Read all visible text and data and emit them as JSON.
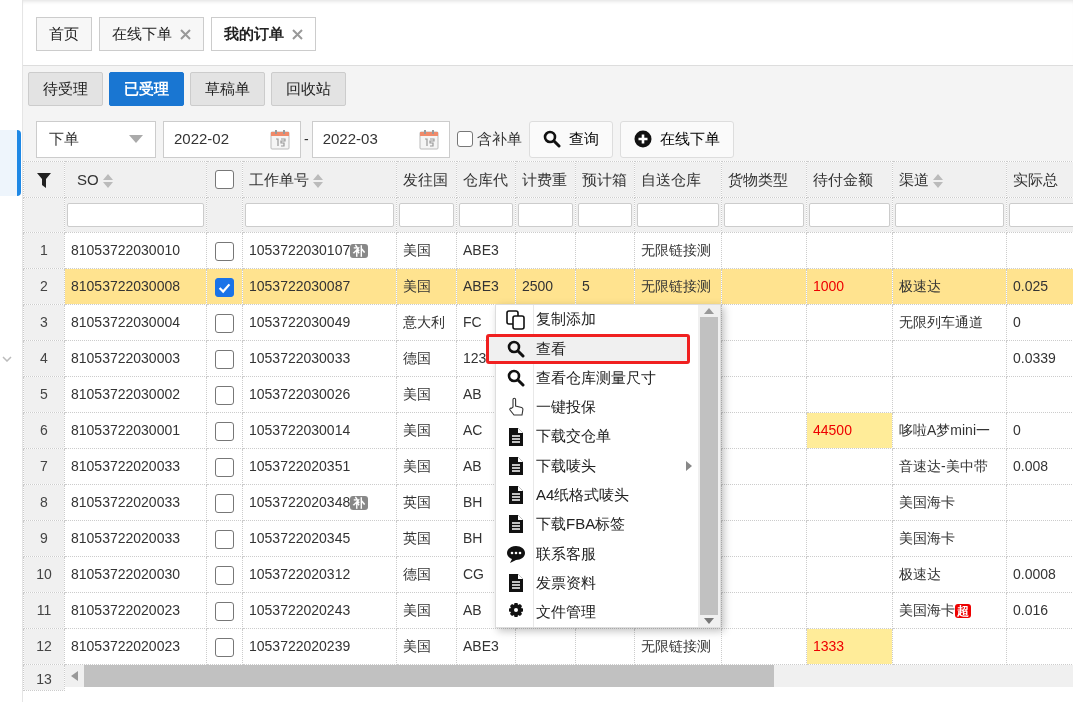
{
  "tabs": [
    {
      "label": "首页",
      "selected": false,
      "closable": false
    },
    {
      "label": "在线下单",
      "selected": false,
      "closable": true
    },
    {
      "label": "我的订单",
      "selected": true,
      "closable": true
    }
  ],
  "status_buttons": [
    {
      "label": "待受理",
      "selected": false
    },
    {
      "label": "已受理",
      "selected": true
    },
    {
      "label": "草稿单",
      "selected": false
    },
    {
      "label": "回收站",
      "selected": false
    }
  ],
  "filters": {
    "date_type": "下单",
    "date_from": "2022-02",
    "separator": "-",
    "date_to": "2022-03",
    "include_supplement": {
      "label": "含补单",
      "checked": false
    },
    "query_button": "查询",
    "new_order_button": "在线下单"
  },
  "table": {
    "header_checked": false,
    "columns": [
      {
        "kind": "text",
        "label": "SO",
        "sortable": true
      },
      {
        "kind": "checkbox"
      },
      {
        "kind": "text",
        "label": "工作单号",
        "sortable": true
      },
      {
        "kind": "text",
        "label": "发往国",
        "sortable": false
      },
      {
        "kind": "text",
        "label": "仓库代",
        "sortable": false
      },
      {
        "kind": "text",
        "label": "计费重",
        "sortable": false
      },
      {
        "kind": "text",
        "label": "预计箱",
        "sortable": false
      },
      {
        "kind": "text",
        "label": "自送仓库",
        "sortable": false
      },
      {
        "kind": "text",
        "label": "货物类型",
        "sortable": false
      },
      {
        "kind": "amount",
        "label": "待付金额",
        "sortable": false
      },
      {
        "kind": "text",
        "label": "渠道",
        "sortable": true
      },
      {
        "kind": "text",
        "label": "实际总",
        "sortable": false
      }
    ],
    "rows": [
      {
        "no": "1",
        "so": "81053722030010",
        "checked": false,
        "selected": false,
        "work_no": "1053722030107",
        "work_badge": "补",
        "country": "美国",
        "warehouse": "ABE3",
        "self_wh": "无限链接测"
      },
      {
        "no": "2",
        "so": "81053722030008",
        "checked": true,
        "selected": true,
        "work_no": "1053722030087",
        "country": "美国",
        "warehouse": "ABE3",
        "weight": "2500",
        "boxes": "5",
        "self_wh": "无限链接测",
        "amount": "1000",
        "channel": "极速达",
        "total": "0.025"
      },
      {
        "no": "3",
        "so": "81053722030004",
        "checked": false,
        "selected": false,
        "work_no": "1053722030049",
        "country": "意大利",
        "warehouse": "FC",
        "channel": "无限列车通道",
        "total": "0"
      },
      {
        "no": "4",
        "so": "81053722030003",
        "checked": false,
        "selected": false,
        "work_no": "1053722030033",
        "country": "德国",
        "warehouse": "123",
        "total": "0.0339"
      },
      {
        "no": "5",
        "so": "81053722030002",
        "checked": false,
        "selected": false,
        "work_no": "1053722030026",
        "country": "美国",
        "warehouse": "AB"
      },
      {
        "no": "6",
        "so": "81053722030001",
        "checked": false,
        "selected": false,
        "work_no": "1053722030014",
        "country": "美国",
        "warehouse": "AC",
        "amount": "44500",
        "channel": "哆啦A梦mini一",
        "total": "0"
      },
      {
        "no": "7",
        "so": "81053722020033",
        "checked": false,
        "selected": false,
        "work_no": "1053722020351",
        "country": "美国",
        "warehouse": "AB",
        "channel": "音速达-美中带",
        "total": "0.008"
      },
      {
        "no": "8",
        "so": "81053722020033",
        "checked": false,
        "selected": false,
        "work_no": "1053722020348",
        "work_badge": "补",
        "country": "英国",
        "warehouse": "BH",
        "channel": "美国海卡"
      },
      {
        "no": "9",
        "so": "81053722020033",
        "checked": false,
        "selected": false,
        "work_no": "1053722020345",
        "country": "英国",
        "warehouse": "BH",
        "channel": "美国海卡"
      },
      {
        "no": "10",
        "so": "81053722020030",
        "checked": false,
        "selected": false,
        "work_no": "1053722020312",
        "country": "德国",
        "warehouse": "CG",
        "channel": "极速达",
        "total": "0.0008"
      },
      {
        "no": "11",
        "so": "81053722020023",
        "checked": false,
        "selected": false,
        "work_no": "1053722020243",
        "country": "美国",
        "warehouse": "AB",
        "channel": "美国海卡",
        "channel_badge": "超",
        "total": "0.016"
      },
      {
        "no": "12",
        "so": "81053722020023",
        "checked": false,
        "selected": false,
        "work_no": "1053722020239",
        "country": "美国",
        "warehouse": "ABE3",
        "self_wh": "无限链接测",
        "amount": "1333"
      }
    ],
    "next_row_no": "13"
  },
  "context_menu": [
    {
      "label": "复制添加",
      "kind": "copy",
      "selected": false,
      "submenu": false
    },
    {
      "label": "查看",
      "kind": "view",
      "selected": true,
      "submenu": false
    },
    {
      "label": "查看仓库测量尺寸",
      "kind": "view",
      "selected": false,
      "submenu": false
    },
    {
      "label": "一键投保",
      "kind": "insure",
      "selected": false,
      "submenu": false
    },
    {
      "label": "下载交仓单",
      "kind": "download",
      "selected": false,
      "submenu": false
    },
    {
      "label": "下载唛头",
      "kind": "download",
      "selected": false,
      "submenu": true
    },
    {
      "label": "A4纸格式唛头",
      "kind": "download",
      "selected": false,
      "submenu": false
    },
    {
      "label": "下载FBA标签",
      "kind": "download",
      "selected": false,
      "submenu": false
    },
    {
      "label": "联系客服",
      "kind": "contact",
      "selected": false,
      "submenu": false
    },
    {
      "label": "发票资料",
      "kind": "download",
      "selected": false,
      "submenu": false
    },
    {
      "label": "文件管理",
      "kind": "settings",
      "selected": false,
      "submenu": false
    }
  ]
}
